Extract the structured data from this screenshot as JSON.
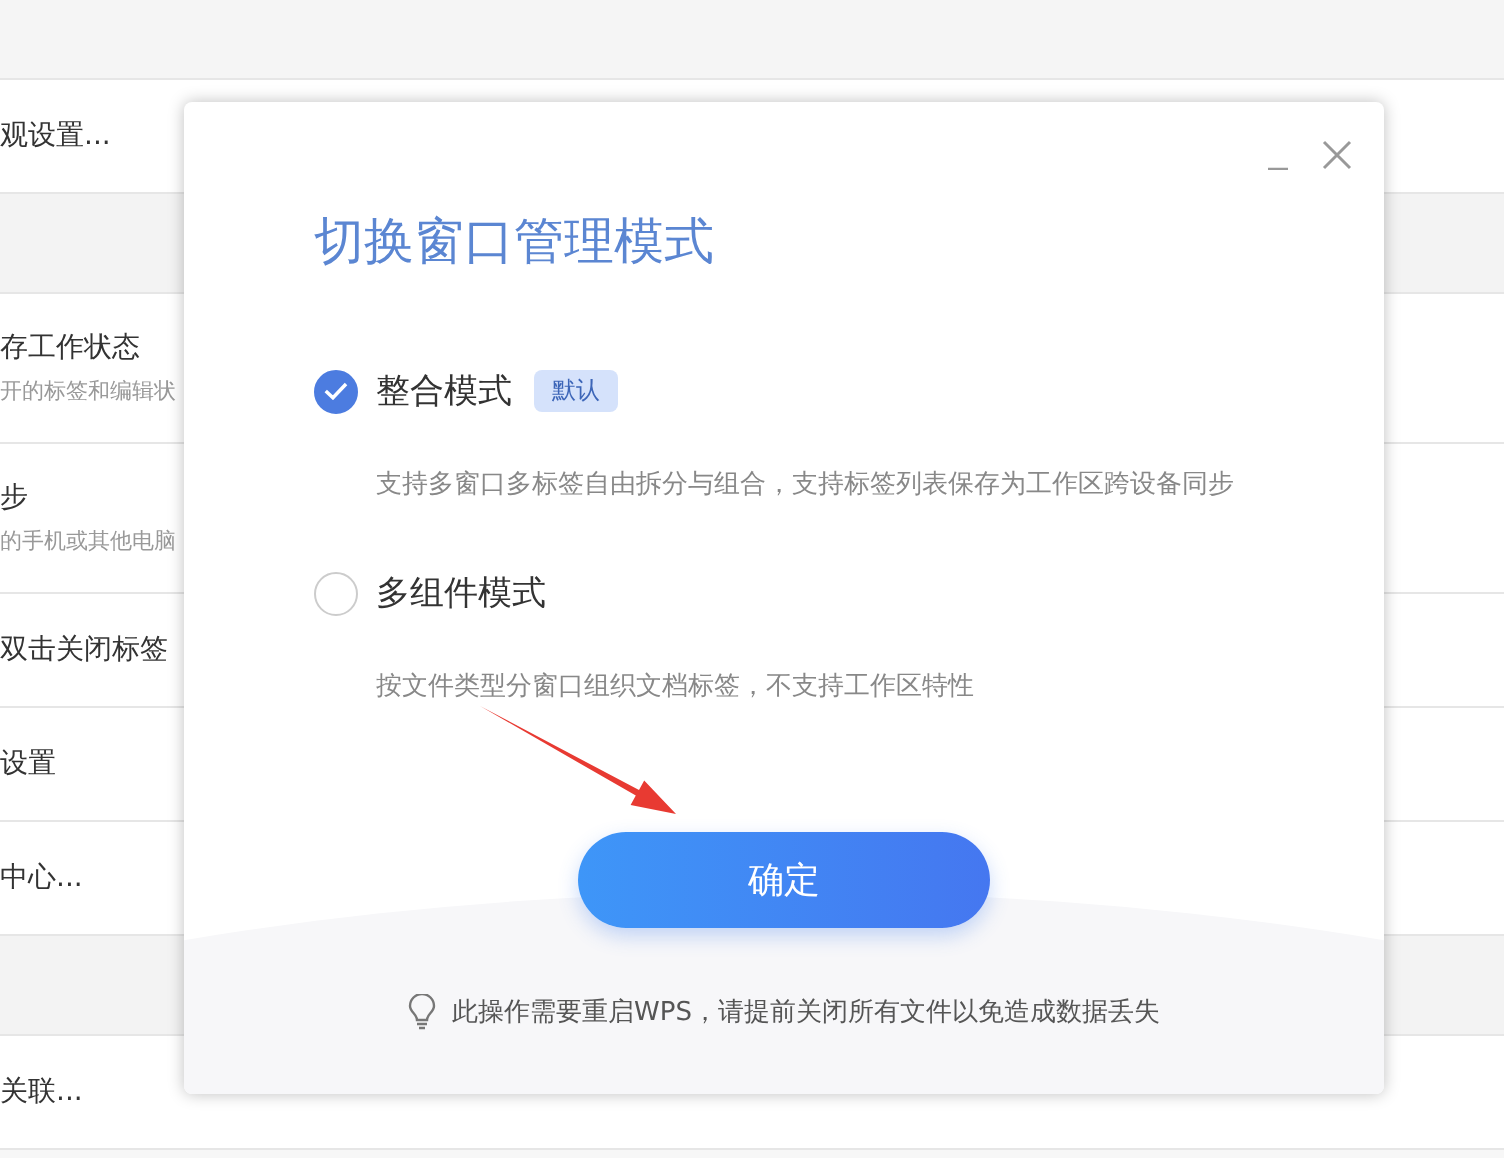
{
  "settings_list": [
    {
      "kind": "gap"
    },
    {
      "kind": "item",
      "title": "观设置..."
    },
    {
      "kind": "section"
    },
    {
      "kind": "item",
      "title": "存工作状态",
      "subtitle": "开的标签和编辑状"
    },
    {
      "kind": "item",
      "title": "步",
      "subtitle": "的手机或其他电脑"
    },
    {
      "kind": "item",
      "title": "双击关闭标签"
    },
    {
      "kind": "item",
      "title": "设置"
    },
    {
      "kind": "item",
      "title": "中心..."
    },
    {
      "kind": "section"
    },
    {
      "kind": "item",
      "title": "关联..."
    }
  ],
  "dialog": {
    "title": "切换窗口管理模式",
    "options": [
      {
        "label": "整合模式",
        "badge": "默认",
        "description": "支持多窗口多标签自由拆分与组合，支持标签列表保存为工作区跨设备同步",
        "selected": true
      },
      {
        "label": "多组件模式",
        "description": "按文件类型分窗口组织文档标签，不支持工作区特性",
        "selected": false
      }
    ],
    "confirm_button": "确定",
    "notice": "此操作需要重启WPS，请提前关闭所有文件以免造成数据丢失"
  }
}
